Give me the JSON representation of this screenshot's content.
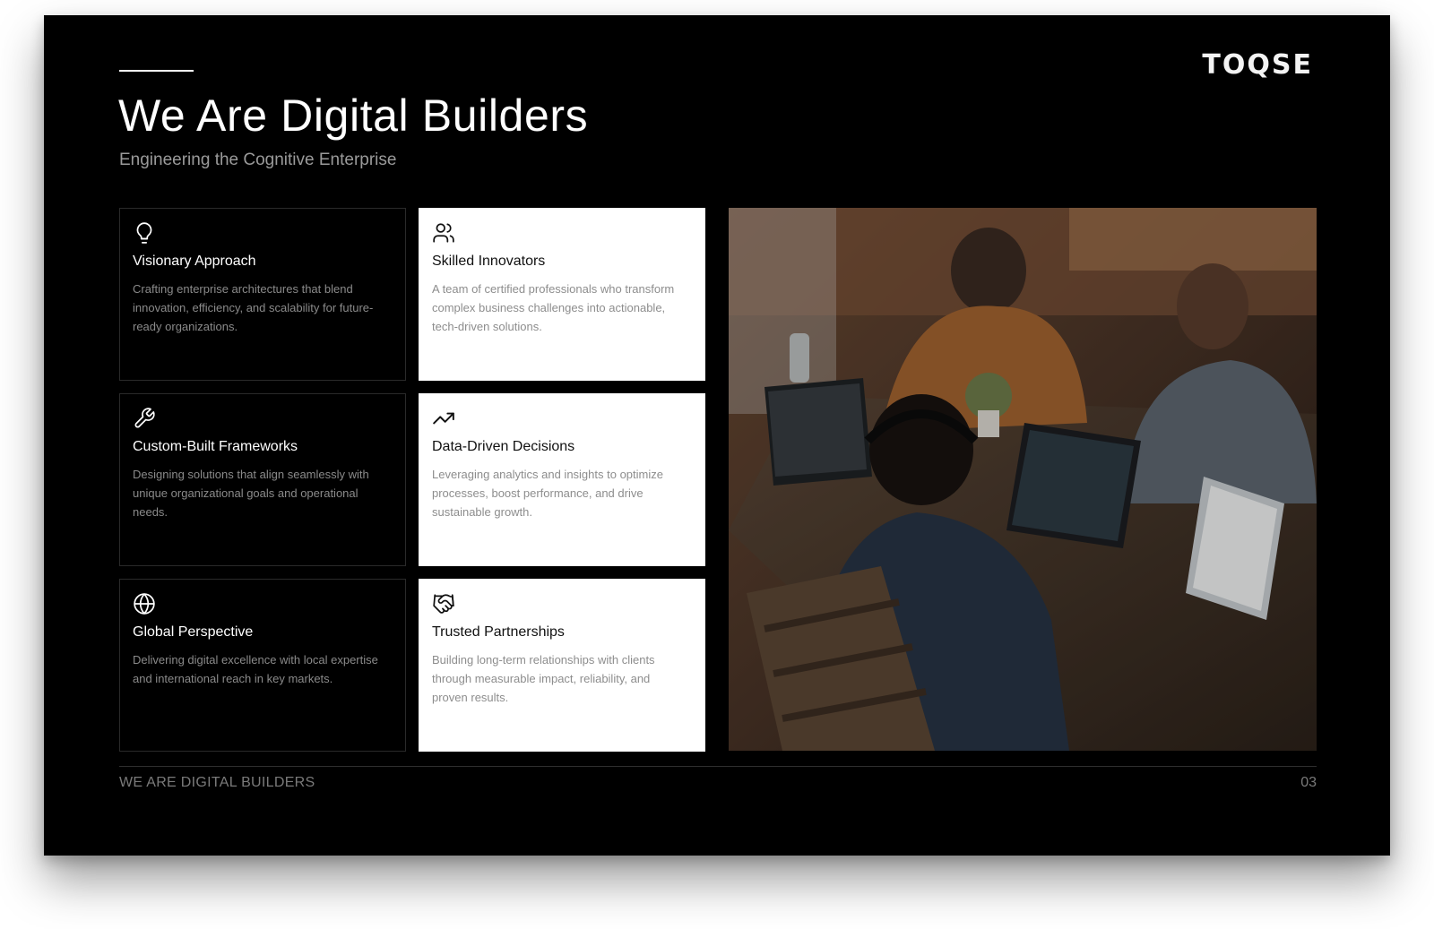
{
  "brand": {
    "logo_text": "TOQSE"
  },
  "header": {
    "title": "We Are Digital Builders",
    "subtitle": "Engineering the Cognitive Enterprise"
  },
  "cards": [
    {
      "icon": "lightbulb-icon",
      "title": "Visionary Approach",
      "description": "Crafting enterprise architectures that blend innovation, efficiency, and scalability for future-ready organizations."
    },
    {
      "icon": "users-icon",
      "title": "Skilled Innovators",
      "description": "A team of certified professionals who transform complex business challenges into actionable, tech-driven solutions."
    },
    {
      "icon": "wrench-icon",
      "title": "Custom-Built Frameworks",
      "description": "Designing solutions that align seamlessly with unique organizational goals and operational needs."
    },
    {
      "icon": "trending-up-icon",
      "title": "Data-Driven Decisions",
      "description": "Leveraging analytics and insights to optimize processes, boost performance, and drive sustainable growth."
    },
    {
      "icon": "globe-icon",
      "title": "Global Perspective",
      "description": "Delivering digital excellence with local expertise and international reach in key markets."
    },
    {
      "icon": "handshake-icon",
      "title": "Trusted Partnerships",
      "description": "Building long-term relationships with clients through measurable impact, reliability, and proven results."
    }
  ],
  "footer": {
    "section_label": "WE ARE DIGITAL BUILDERS",
    "page_number": "03"
  },
  "colors": {
    "slide_background": "#000000",
    "light_card": "#ffffff",
    "muted_text": "#8a8a8a"
  }
}
